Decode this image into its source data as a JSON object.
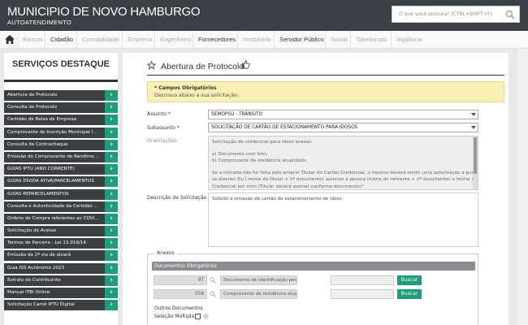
{
  "header": {
    "title": "MUNICIPIO DE NOVO HAMBURGO",
    "subtitle": "AUTOATENDIMENTO",
    "search_placeholder": "O que você procura? (CTRL+SHIFT+F)"
  },
  "nav": {
    "items": [
      {
        "label": "Bancos",
        "active": false
      },
      {
        "label": "Cidadão",
        "active": true
      },
      {
        "label": "Contabilidade",
        "active": false
      },
      {
        "label": "Empresa",
        "active": false
      },
      {
        "label": "Engenheiro",
        "active": false
      },
      {
        "label": "Fornecedores",
        "active": true
      },
      {
        "label": "Imobiliária",
        "active": false
      },
      {
        "label": "Servidor Público",
        "active": true
      },
      {
        "label": "Social",
        "active": false
      },
      {
        "label": "Tabelionato",
        "active": false
      },
      {
        "label": "Vigilância",
        "active": false
      }
    ]
  },
  "sidebar": {
    "heading": "SERVIÇOS DESTAQUE",
    "items": [
      {
        "label": "Abertura de Protocolo"
      },
      {
        "label": "Consulta de Protocolo"
      },
      {
        "label": "Certidão de Baixa de Empresa"
      },
      {
        "label": "Comprovante de Inscrição Municipal (..."
      },
      {
        "label": "Consulta de Contracheque"
      },
      {
        "label": "Emissão do Comprovante de Rendime..."
      },
      {
        "label": "GUIAS IPTU (ANO CORRENTE)"
      },
      {
        "label": "GUIAS DÍVIDA ATIVA/PARCELAMENTOS"
      },
      {
        "label": "GUIAS REPARCELAMENTOS"
      },
      {
        "label": "Consulta e Autenticidade da Certidão ..."
      },
      {
        "label": "Ordens de Compra referentes ao COVI..."
      },
      {
        "label": "Solicitação de Acesso"
      },
      {
        "label": "Termos de Parceria - Lei 13.019/14"
      },
      {
        "label": "Emissão de 2ª via de alvará"
      },
      {
        "label": "Guia ISS Autônomo 2023"
      },
      {
        "label": "Extrato do Contribuinte"
      },
      {
        "label": "Manual ITBI Online"
      },
      {
        "label": "Solicitação Carnê IPTU Digital"
      }
    ]
  },
  "main": {
    "title": "Abertura de Protocolo",
    "notice_title": "* Campos Obrigatórios",
    "notice_text": "Descreva abaixo a sua solicitação:",
    "assunto_label": "Assunto *",
    "assunto_value": "SEMOPSU - TRÂNSITO",
    "subassunto_label": "Subassunto *",
    "subassunto_value": "SOLICITAÇÃO DE CARTÃO DE ESTACIONAMENTO PARA IDOSOS",
    "orientacoes_label": "Orientações:",
    "orientacoes_lines": [
      "Solicitação de credencial para idoso anexar:",
      "",
      "a) Documento com foto;",
      "b) Comprovante de residência atualizado.",
      "",
      "Se a retirada não for feita pelo próprio Titular do Cartão Credencial, o mesmo deverá emitir uma autorização a punho com",
      "os dizeres: Eu ( nome do titular + nº documento) autorizo a pessoa (nome do retirante + nº documento) a retirar minha",
      "Credencial por mim (Titular deverá assinar conforme documento)*"
    ],
    "descricao_label": "Descrição da Solicitação *",
    "descricao_value": "Solicito a emissão de cartão do estacionamento de idoso",
    "anexos_legend": "Anexos",
    "docs_header": "Documentos Obrigatórios",
    "docs": [
      {
        "num": "97",
        "name": "Documento de Identificação pesso",
        "button": "Buscar"
      },
      {
        "num": "559",
        "name": "Comprovante de residência atualiz",
        "button": "Buscar"
      }
    ],
    "outros_label": "Outros Documentos",
    "selecao_label": "Seleção Múltipla:"
  },
  "colors": {
    "header_bg": "#3a3e45",
    "accent_green": "#1a9e7b",
    "notice_bg": "#fbf0b3"
  }
}
